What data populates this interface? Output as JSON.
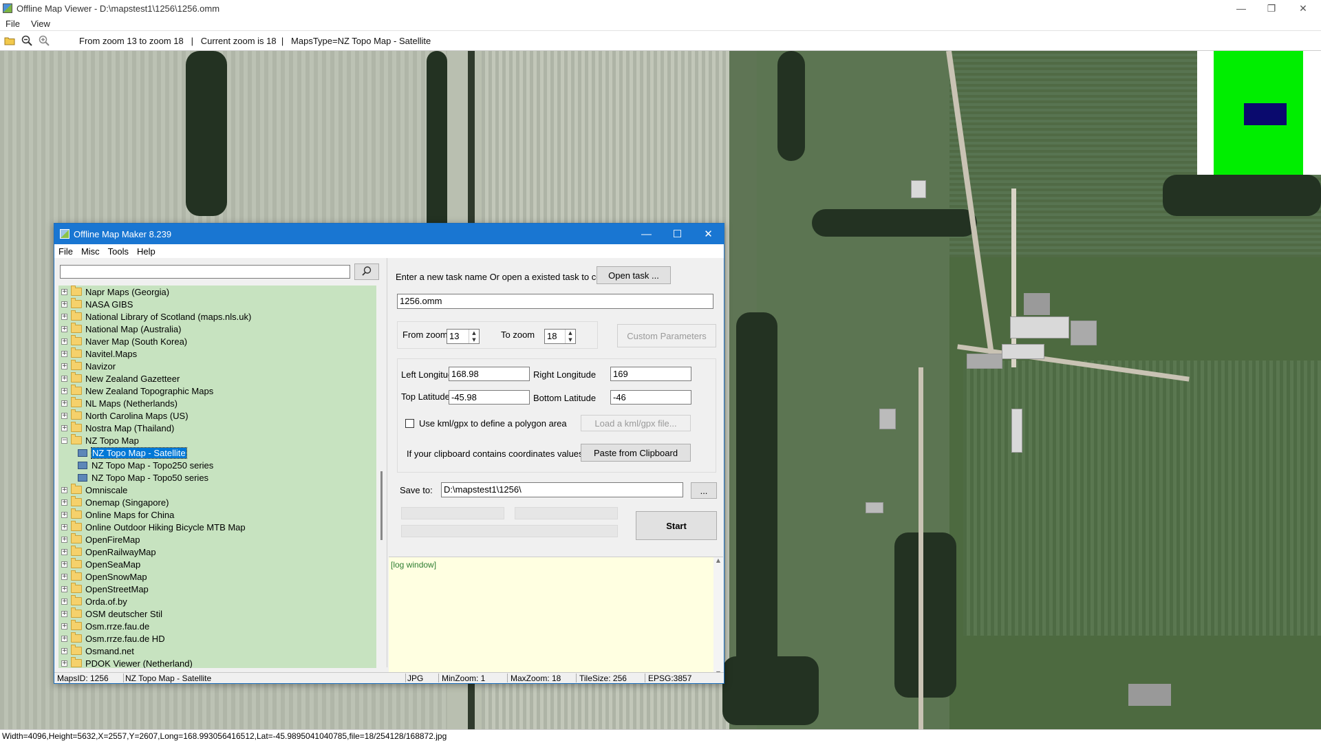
{
  "viewer": {
    "title": "Offline Map Viewer - D:\\mapstest1\\1256\\1256.omm",
    "menu": [
      "File",
      "View"
    ],
    "status_bar": "From zoom 13 to zoom 18   |   Current zoom is 18  |   MapsType=NZ Topo Map - Satellite",
    "bottom_status": "Width=4096,Height=5632,X=2557,Y=2607,Long=168.993056416512,Lat=-45.9895041040785,file=18/254128/168872.jpg",
    "minimap_colors": {
      "bg": "#00ee00",
      "viewport": "#0a0a6e"
    }
  },
  "dialog": {
    "title": "Offline Map Maker 8.239",
    "menu": [
      "File",
      "Misc",
      "Tools",
      "Help"
    ],
    "search": {
      "value": "",
      "placeholder": ""
    },
    "tree": [
      {
        "label": "Napr Maps (Georgia)",
        "type": "folder",
        "expanded": false
      },
      {
        "label": "NASA GIBS",
        "type": "folder",
        "expanded": false
      },
      {
        "label": "National Library of Scotland (maps.nls.uk)",
        "type": "folder",
        "expanded": false
      },
      {
        "label": "National Map (Australia)",
        "type": "folder",
        "expanded": false
      },
      {
        "label": "Naver Map (South Korea)",
        "type": "folder",
        "expanded": false
      },
      {
        "label": "Navitel.Maps",
        "type": "folder",
        "expanded": false
      },
      {
        "label": "Navizor",
        "type": "folder",
        "expanded": false
      },
      {
        "label": "New Zealand Gazetteer",
        "type": "folder",
        "expanded": false
      },
      {
        "label": "New Zealand Topographic Maps",
        "type": "folder",
        "expanded": false
      },
      {
        "label": "NL Maps (Netherlands)",
        "type": "folder",
        "expanded": false
      },
      {
        "label": "North Carolina Maps (US)",
        "type": "folder",
        "expanded": false
      },
      {
        "label": "Nostra Map (Thailand)",
        "type": "folder",
        "expanded": false
      },
      {
        "label": "NZ Topo Map",
        "type": "folder",
        "expanded": true
      },
      {
        "label": "NZ Topo Map - Satellite",
        "type": "map",
        "selected": true
      },
      {
        "label": "NZ Topo Map - Topo250 series",
        "type": "map"
      },
      {
        "label": "NZ Topo Map - Topo50 series",
        "type": "map"
      },
      {
        "label": "Omniscale",
        "type": "folder",
        "expanded": false
      },
      {
        "label": "Onemap (Singapore)",
        "type": "folder",
        "expanded": false
      },
      {
        "label": "Online Maps for China",
        "type": "folder",
        "expanded": false
      },
      {
        "label": "Online Outdoor Hiking Bicycle MTB Map",
        "type": "folder",
        "expanded": false
      },
      {
        "label": "OpenFireMap",
        "type": "folder",
        "expanded": false
      },
      {
        "label": "OpenRailwayMap",
        "type": "folder",
        "expanded": false
      },
      {
        "label": "OpenSeaMap",
        "type": "folder",
        "expanded": false
      },
      {
        "label": "OpenSnowMap",
        "type": "folder",
        "expanded": false
      },
      {
        "label": "OpenStreetMap",
        "type": "folder",
        "expanded": false
      },
      {
        "label": "Orda.of.by",
        "type": "folder",
        "expanded": false
      },
      {
        "label": "OSM deutscher Stil",
        "type": "folder",
        "expanded": false
      },
      {
        "label": "Osm.rrze.fau.de",
        "type": "folder",
        "expanded": false
      },
      {
        "label": "Osm.rrze.fau.de HD",
        "type": "folder",
        "expanded": false
      },
      {
        "label": "Osmand.net",
        "type": "folder",
        "expanded": false
      },
      {
        "label": "PDOK Viewer (Netherland)",
        "type": "folder",
        "expanded": false
      }
    ],
    "task_prompt": "Enter a new task name Or open a existed task to continue:",
    "open_task_label": "Open task ...",
    "task_name": "1256.omm",
    "from_zoom_label": "From zoom",
    "from_zoom": "13",
    "to_zoom_label": "To zoom",
    "to_zoom": "18",
    "custom_params_label": "Custom Parameters",
    "left_lon_label": "Left Longitude",
    "left_lon": "168.98",
    "right_lon_label": "Right Longitude",
    "right_lon": "169",
    "top_lat_label": "Top Latitude",
    "top_lat": "-45.98",
    "bottom_lat_label": "Bottom Latitude",
    "bottom_lat": "-46",
    "kml_label": "Use kml/gpx to define a polygon area",
    "load_kml_label": "Load a kml/gpx file...",
    "clipboard_label": "If your clipboard contains coordinates values:",
    "paste_label": "Paste from Clipboard",
    "save_to_label": "Save to:",
    "save_to": "D:\\mapstest1\\1256\\",
    "browse_label": "...",
    "start_label": "Start",
    "log_text": "[log window]",
    "status": {
      "maps_id": "MapsID: 1256",
      "map_name": "NZ Topo Map - Satellite",
      "format": "JPG",
      "min_zoom": "MinZoom: 1",
      "max_zoom": "MaxZoom: 18",
      "tile_size": "TileSize: 256",
      "epsg": "EPSG:3857"
    }
  }
}
